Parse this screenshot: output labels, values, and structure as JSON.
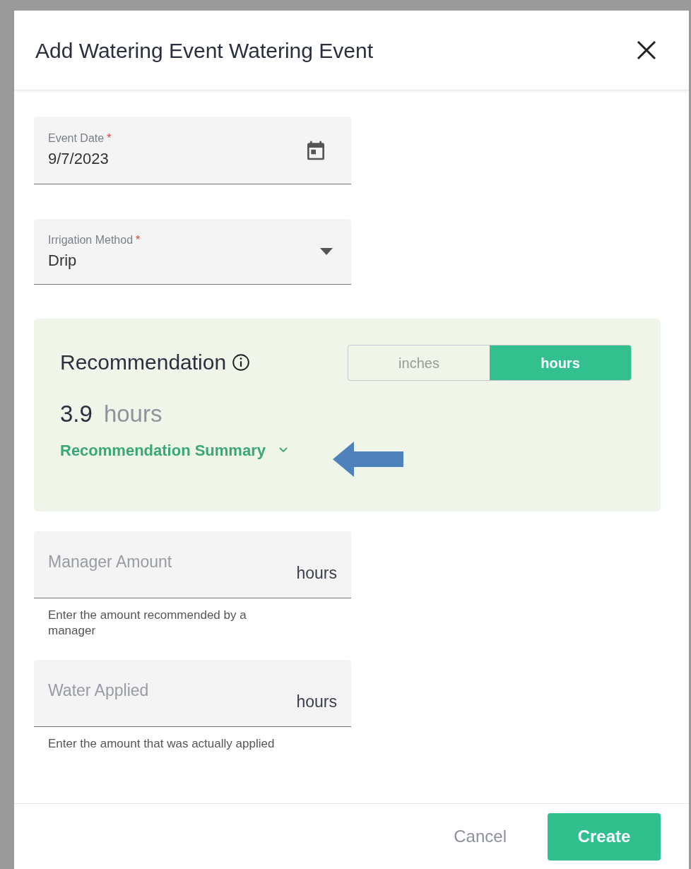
{
  "dialog": {
    "title": "Add Watering Event Watering Event"
  },
  "date_field": {
    "label": "Event Date",
    "required_mark": "*",
    "value": "9/7/2023"
  },
  "method_field": {
    "label": "Irrigation Method",
    "required_mark": "*",
    "value": "Drip"
  },
  "recommendation": {
    "title": "Recommendation",
    "units": [
      {
        "label": "inches",
        "selected": false
      },
      {
        "label": "hours",
        "selected": true
      }
    ],
    "value": "3.9",
    "unit": "hours",
    "summary_link": "Recommendation Summary",
    "expanded": false
  },
  "amount_fields": [
    {
      "placeholder": "Manager Amount",
      "suffix": "hours",
      "helper": "Enter the amount recommended by a manager"
    },
    {
      "placeholder": "Water Applied",
      "suffix": "hours",
      "helper": "Enter the amount that was actually applied"
    }
  ],
  "buttons": [
    {
      "label": "Cancel",
      "kind": "text"
    },
    {
      "label": "Create",
      "kind": "primary"
    }
  ]
}
